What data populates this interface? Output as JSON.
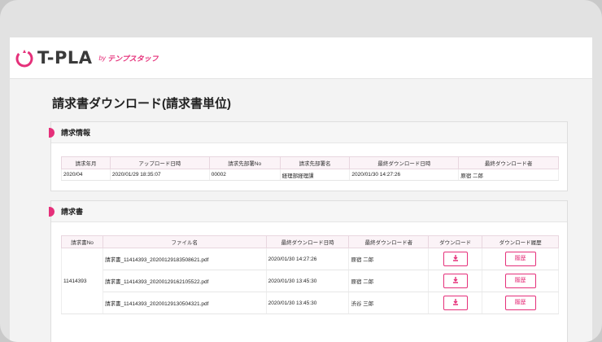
{
  "header": {
    "logo_text": "T-PLA",
    "logo_by": "by",
    "logo_brand": "テンプスタッフ"
  },
  "page": {
    "title": "請求書ダウンロード(請求書単位)"
  },
  "billing_info": {
    "section_label": "請求情報",
    "columns": [
      "請求年月",
      "アップロード日時",
      "請求先部署No",
      "請求先部署名",
      "最終ダウンロード日時",
      "最終ダウンロード者"
    ],
    "row": [
      "2020/04",
      "2020/01/29 18:35:07",
      "00002",
      "経理部経理課",
      "2020/01/30 14:27:26",
      "原宿 二郎"
    ]
  },
  "invoices": {
    "section_label": "請求書",
    "columns": [
      "請求書No",
      "ファイル名",
      "最終ダウンロード日時",
      "最終ダウンロード者",
      "ダウンロード",
      "ダウンロード履歴"
    ],
    "invoice_no": "11414393",
    "history_label": "履歴",
    "rows": [
      {
        "file": "請求書_11414393_20200129183508621.pdf",
        "last_dl": "2020/01/30 14:27:26",
        "user": "原宿 二郎"
      },
      {
        "file": "請求書_11414393_20200129162105522.pdf",
        "last_dl": "2020/01/30 13:45:30",
        "user": "原宿 二郎"
      },
      {
        "file": "請求書_11414393_20200129130504321.pdf",
        "last_dl": "2020/01/30 13:45:30",
        "user": "渋谷 三郎"
      }
    ]
  },
  "colors": {
    "accent": "#e5307a",
    "logo_dark": "#3a3a3a"
  }
}
